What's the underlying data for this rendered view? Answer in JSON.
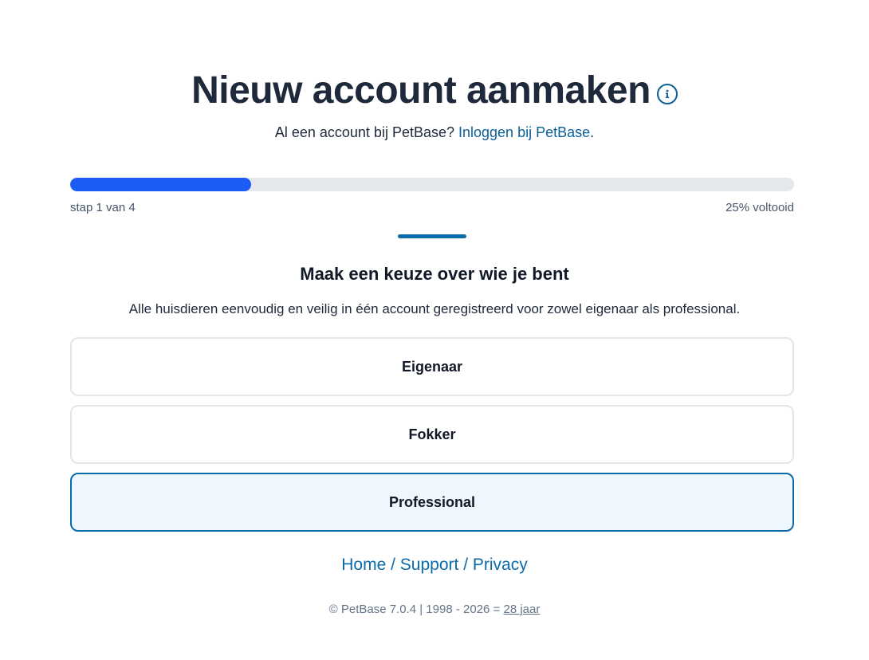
{
  "header": {
    "title": "Nieuw account aanmaken",
    "info_icon": "info-icon"
  },
  "login": {
    "prefix": "Al een account bij PetBase? ",
    "link": "Inloggen bij PetBase",
    "suffix": "."
  },
  "progress": {
    "percent": 25,
    "step_label": "stap 1 van 4",
    "percent_label": "25% voltooid",
    "fill_color": "#1c5cf4"
  },
  "section": {
    "title": "Maak een keuze over wie je bent",
    "subtitle": "Alle huisdieren eenvoudig en veilig in één account geregistreerd voor zowel eigenaar als professional."
  },
  "options": [
    {
      "label": "Eigenaar",
      "selected": false
    },
    {
      "label": "Fokker",
      "selected": false
    },
    {
      "label": "Professional",
      "selected": true
    }
  ],
  "footer": {
    "links": [
      "Home",
      "Support",
      "Privacy"
    ],
    "separator": " / ",
    "copyright_prefix": "© PetBase 7.0.4 | 1998 - 2026 = ",
    "years_link": "28 jaar"
  },
  "colors": {
    "accent": "#0b6aa8",
    "selected_bg": "#eef7fe"
  }
}
